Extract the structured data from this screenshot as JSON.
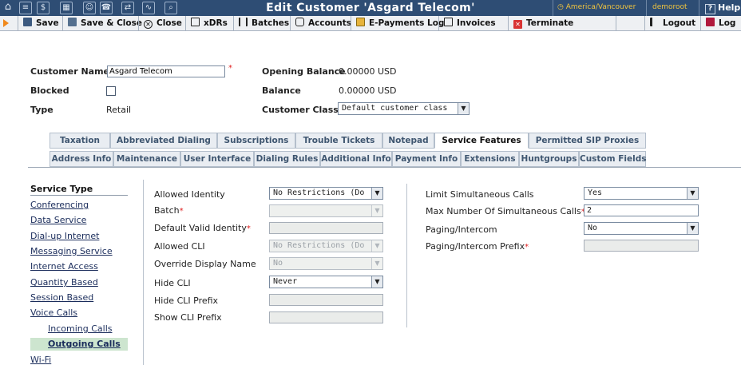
{
  "header": {
    "title": "Edit Customer 'Asgard Telecom'",
    "timezone": "America/Vancouver",
    "user": "demoroot",
    "help_label": "Help"
  },
  "toolbar": {
    "save": "Save",
    "save_close": "Save & Close",
    "close": "Close",
    "xdrs": "xDRs",
    "batches": "Batches",
    "accounts": "Accounts",
    "epayments": "E-Payments Log",
    "invoices": "Invoices",
    "terminate": "Terminate",
    "logout": "Logout",
    "log": "Log"
  },
  "customer": {
    "name_label": "Customer Name",
    "name_value": "Asgard Telecom",
    "blocked_label": "Blocked",
    "type_label": "Type",
    "type_value": "Retail",
    "opening_balance_label": "Opening Balance",
    "opening_balance_value": "0.00000 USD",
    "balance_label": "Balance",
    "balance_value": "0.00000 USD",
    "class_label": "Customer Class",
    "class_value": "Default customer class"
  },
  "tabs": {
    "row1": [
      "Taxation",
      "Abbreviated Dialing",
      "Subscriptions",
      "Trouble Tickets",
      "Notepad",
      "Service Features",
      "Permitted SIP Proxies"
    ],
    "row2": [
      "Address Info",
      "Maintenance",
      "User Interface",
      "Dialing Rules",
      "Additional Info",
      "Payment Info",
      "Extensions",
      "Huntgroups",
      "Custom Fields"
    ],
    "active": "Service Features"
  },
  "nav": {
    "heading": "Service Type",
    "items": [
      "Conferencing",
      "Data Service",
      "Dial-up Internet",
      "Messaging Service",
      "Internet Access",
      "Quantity Based",
      "Session Based",
      "Voice Calls",
      "Incoming Calls",
      "Outgoing Calls",
      "Wi-Fi"
    ]
  },
  "form_left": {
    "allowed_identity_label": "Allowed Identity",
    "allowed_identity_value": "No Restrictions (Do",
    "batch_label": "Batch",
    "default_valid_identity_label": "Default Valid Identity",
    "allowed_cli_label": "Allowed CLI",
    "allowed_cli_value": "No Restrictions (Do",
    "override_display_name_label": "Override Display Name",
    "override_display_name_value": "No",
    "hide_cli_label": "Hide CLI",
    "hide_cli_value": "Never",
    "hide_cli_prefix_label": "Hide CLI Prefix",
    "show_cli_prefix_label": "Show CLI Prefix"
  },
  "form_right": {
    "limit_simultaneous_label": "Limit Simultaneous Calls",
    "limit_simultaneous_value": "Yes",
    "max_simultaneous_label": "Max Number Of Simultaneous Calls",
    "max_simultaneous_value": "2",
    "paging_label": "Paging/Intercom",
    "paging_value": "No",
    "paging_prefix_label": "Paging/Intercom Prefix"
  },
  "colors": {
    "header_bg": "#2e4d74",
    "accent_yellow": "#f0c43f",
    "required_red": "#e02020",
    "active_nav_bg": "#cde5cf"
  }
}
